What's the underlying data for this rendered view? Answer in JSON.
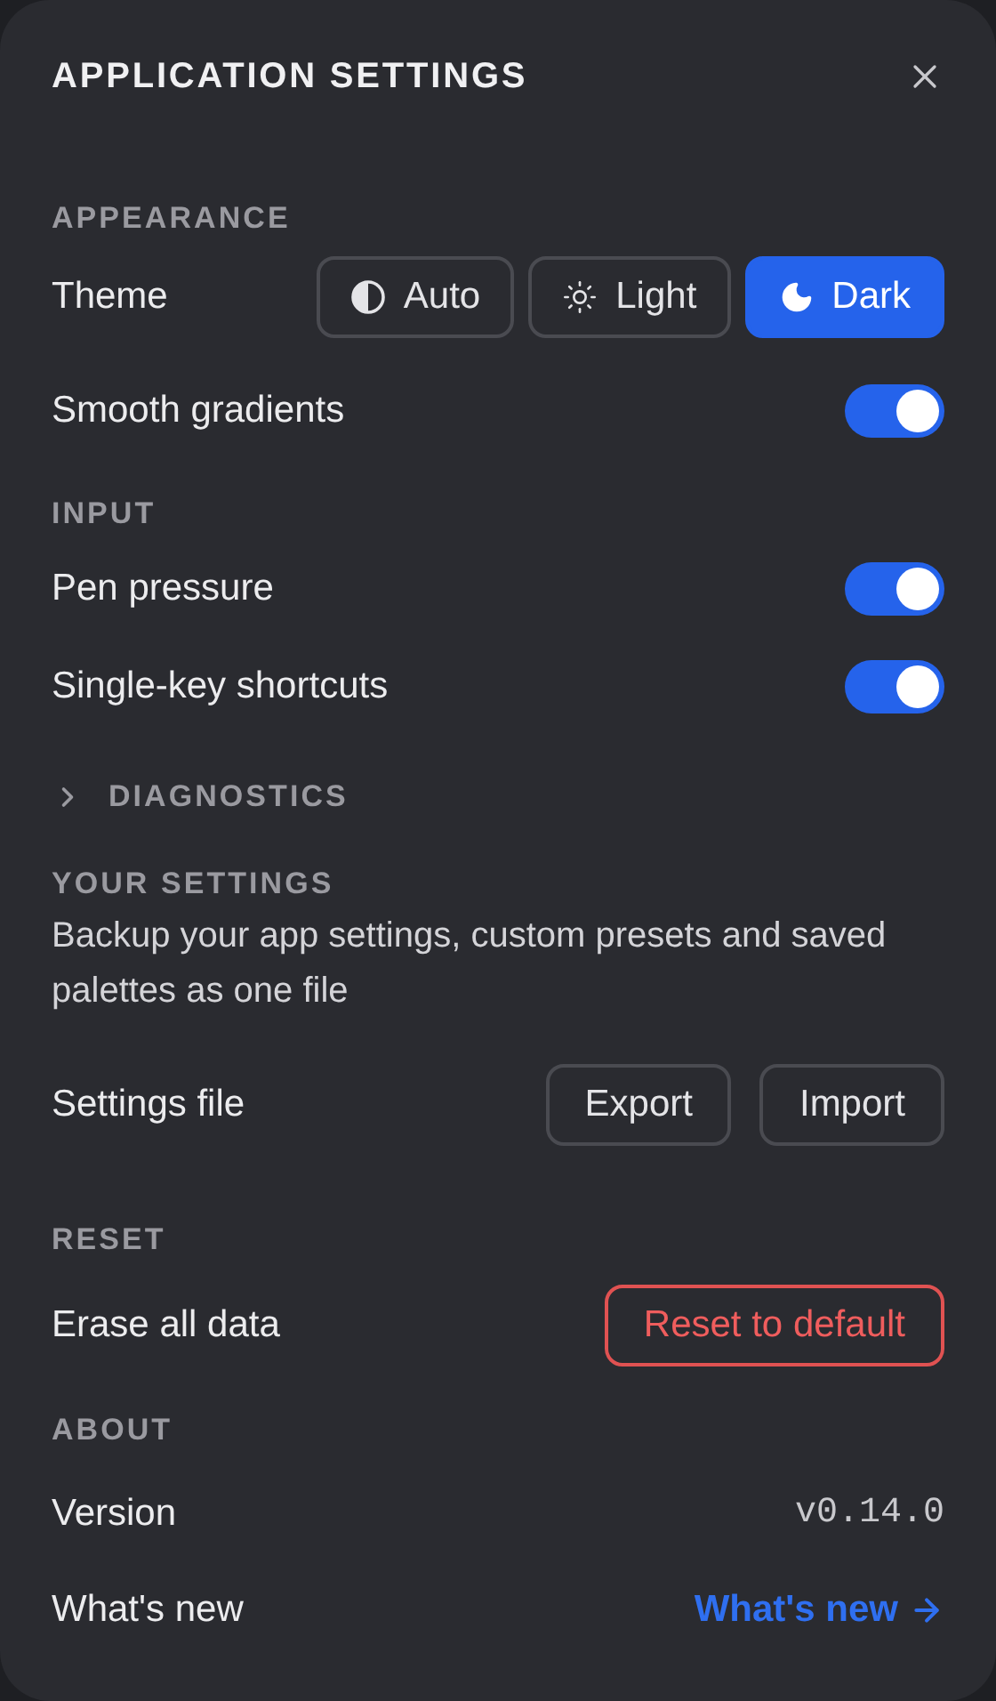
{
  "dialog": {
    "title": "APPLICATION SETTINGS"
  },
  "sections": [
    {
      "kind": "group",
      "heading": "APPEARANCE",
      "rows": [
        {
          "kind": "segmented",
          "label": "Theme",
          "options": [
            {
              "label": "Auto",
              "selected": false
            },
            {
              "label": "Light",
              "selected": false
            },
            {
              "label": "Dark",
              "selected": true
            }
          ]
        },
        {
          "kind": "toggle",
          "label": "Smooth gradients",
          "on": true
        }
      ]
    },
    {
      "kind": "group",
      "heading": "INPUT",
      "rows": [
        {
          "kind": "toggle",
          "label": "Pen pressure",
          "on": true
        },
        {
          "kind": "toggle",
          "label": "Single-key shortcuts",
          "on": true
        }
      ]
    },
    {
      "kind": "collapsible",
      "heading": "DIAGNOSTICS",
      "expanded": false
    },
    {
      "kind": "group",
      "heading": "YOUR SETTINGS",
      "description": "Backup your app settings, custom presets and saved palettes as one file",
      "rows": [
        {
          "kind": "buttons",
          "label": "Settings file",
          "buttons": [
            "Export",
            "Import"
          ]
        }
      ]
    },
    {
      "kind": "group",
      "heading": "RESET",
      "rows": [
        {
          "kind": "danger",
          "label": "Erase all data",
          "button": "Reset to default"
        }
      ]
    },
    {
      "kind": "group",
      "heading": "ABOUT",
      "rows": [
        {
          "kind": "value",
          "label": "Version",
          "value": "v0.14.0"
        },
        {
          "kind": "link",
          "label": "What's new",
          "link": "What's new"
        }
      ]
    }
  ]
}
